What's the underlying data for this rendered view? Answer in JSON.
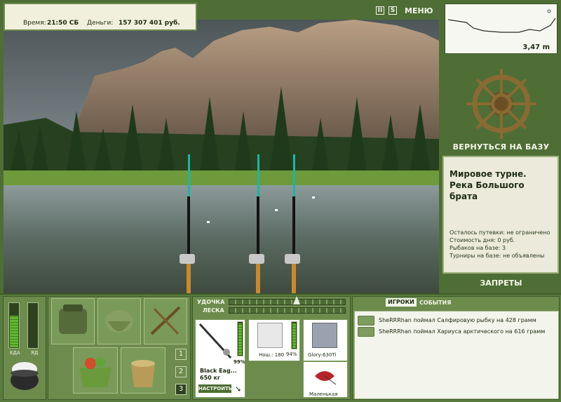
{
  "header": {
    "time_label": "Время:",
    "time_value": "21:50 СБ",
    "money_label": "Деньги:",
    "money_value": "157 307 401 руб."
  },
  "top_icons": {
    "pause": "II",
    "sound": "S",
    "menu": "МЕНЮ"
  },
  "depth": {
    "value": "3,47 m"
  },
  "base": {
    "return_label": "ВЕРНУТЬСЯ НА БАЗУ",
    "location_title": "Мировое турне. Река Большого брата",
    "rows": [
      "Осталось путевки: не ограничено",
      "Стоимость дня: 0 руб.",
      "Рыбаков на базе: 3",
      "Турниры на базе: не объявлены"
    ],
    "bans_label": "ЗАПРЕТЫ"
  },
  "status": {
    "food_label": "ЕДА",
    "poison_label": "ЯД",
    "food_level": 0.72,
    "poison_level": 0
  },
  "tackle": {
    "rod_label": "УДОЧКА",
    "line_label": "ЛЕСКА",
    "rod_name": "Black Eag...",
    "rod_weight": "650 кг",
    "rod_durability": "99%",
    "reel_wear": "Нош.: 180",
    "reel_durability": "94%",
    "line_name": "Glory-630Ti",
    "bait_name": "Маленькая",
    "setup_button": "НАСТРОИТЬ"
  },
  "rod_slots": [
    "1",
    "2",
    "3"
  ],
  "tabs": {
    "players": "ИГРОКИ",
    "events": "СОБЫТИЯ"
  },
  "log": [
    "SheRRRhan поймал Салфировую рыбку на 428 грамм",
    "SheRRRhan поймал Хариуса арктического на 616 грамм"
  ],
  "colors": {
    "panel_green": "#4e6e35",
    "bar_green": "#63b82f",
    "info_bg": "#ebeadb"
  }
}
